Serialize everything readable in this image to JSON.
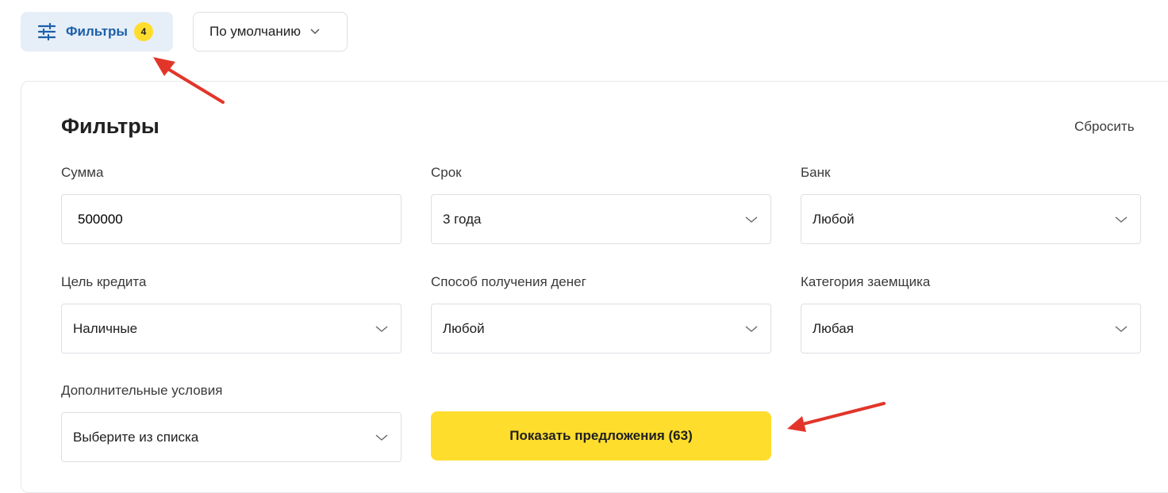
{
  "toolbar": {
    "filters_label": "Фильтры",
    "filters_count": "4",
    "sort_label": "По умолчанию"
  },
  "panel": {
    "title": "Фильтры",
    "reset_label": "Сбросить"
  },
  "fields": {
    "amount": {
      "label": "Сумма",
      "value": "500000"
    },
    "term": {
      "label": "Срок",
      "value": "3 года"
    },
    "bank": {
      "label": "Банк",
      "value": "Любой"
    },
    "purpose": {
      "label": "Цель кредита",
      "value": "Наличные"
    },
    "method": {
      "label": "Способ получения денег",
      "value": "Любой"
    },
    "category": {
      "label": "Категория заемщика",
      "value": "Любая"
    },
    "extra": {
      "label": "Дополнительные условия",
      "value": "Выберите из списка"
    }
  },
  "cta": {
    "label": "Показать предложения (63)"
  },
  "colors": {
    "accent_yellow": "#ffdd2d",
    "filters_bg": "#e6eef7",
    "filters_text": "#1b5fa8",
    "annotation_red": "#e2352a"
  },
  "icons": {
    "filters": "sliders-icon",
    "chevron": "chevron-down-icon"
  }
}
